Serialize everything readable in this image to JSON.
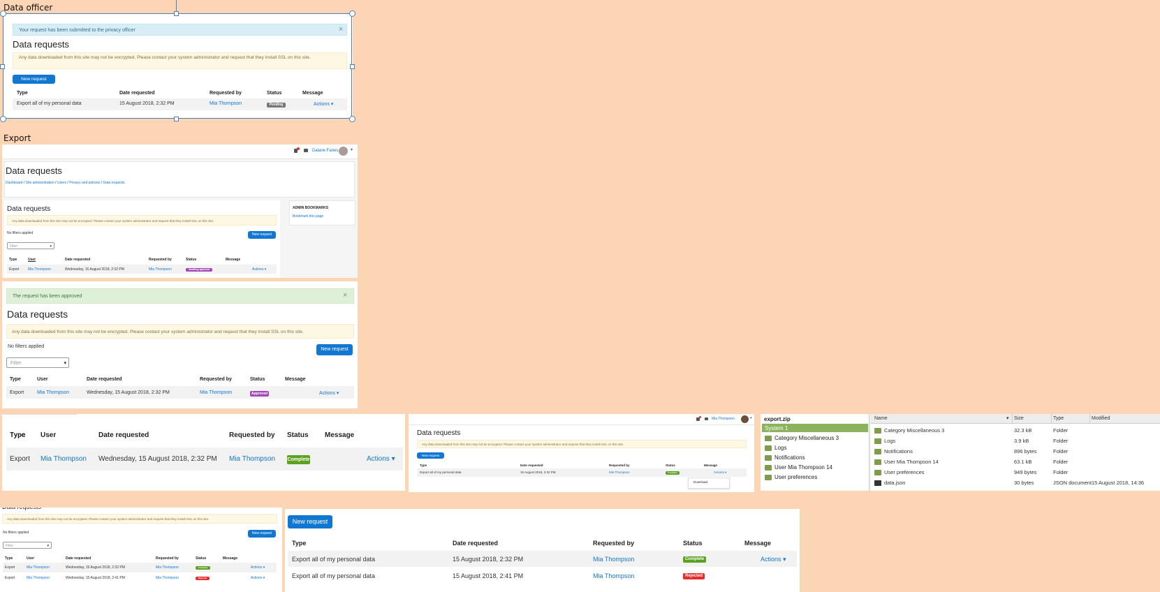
{
  "labels": {
    "data_officer": "Data officer",
    "export": "Export"
  },
  "common": {
    "page_title": "Data requests",
    "ssl_warning_a": "Any data downloaded from this site may not be encrypted. Please contact your system administrator and request that they install SSL on this site.",
    "new_request": "New request",
    "no_filters": "No filters applied",
    "filter_placeholder": "Filter",
    "actions": "Actions ▾",
    "close": "×"
  },
  "panel1": {
    "alert": "Your request has been submitted to the privacy officer",
    "headers": [
      "Type",
      "Date requested",
      "Requested by",
      "Status",
      "Message"
    ],
    "row": {
      "type": "Export all of my personal data",
      "date": "15 August 2018, 2:32 PM",
      "by": "Mia Thompson",
      "status": "Pending"
    }
  },
  "panel2": {
    "user": "Dalane Fanes",
    "breadcrumb": [
      "Dashboard",
      "Site administration",
      "Users",
      "Privacy and policies",
      "Data requests"
    ],
    "block_title": "ADMIN BOOKMARKS",
    "block_link": "Bookmark this page",
    "headers": [
      "Type",
      "User",
      "Date requested",
      "Requested by",
      "Status",
      "Message"
    ],
    "row": {
      "type": "Export",
      "user": "Mia Thompson",
      "date": "Wednesday, 15 August 2018, 2:32 PM",
      "by": "Mia Thompson",
      "status": "Awaiting approval"
    }
  },
  "panel3": {
    "alert": "The request has been approved",
    "headers": [
      "Type",
      "User",
      "Date requested",
      "Requested by",
      "Status",
      "Message"
    ],
    "row": {
      "type": "Export",
      "user": "Mia Thompson",
      "date": "Wednesday, 15 August 2018, 2:32 PM",
      "by": "Mia Thompson",
      "status": "Approved"
    }
  },
  "panel4": {
    "headers": [
      "Type",
      "User",
      "Date requested",
      "Requested by",
      "Status",
      "Message"
    ],
    "row": {
      "type": "Export",
      "user": "Mia Thompson",
      "date": "Wednesday, 15 August 2018, 2:32 PM",
      "by": "Mia Thompson",
      "status": "Complete"
    }
  },
  "panel5": {
    "user": "Mia Thompson",
    "headers": [
      "Type",
      "Date requested",
      "Requested by",
      "Status",
      "Message"
    ],
    "row": {
      "type": "Export all of my personal data",
      "date": "15 August 2018, 2:32 PM",
      "by": "Mia Thompson",
      "status": "Complete"
    },
    "menu_item": "Download"
  },
  "panel6": {
    "archive": "export.zip",
    "tree": [
      "System 1",
      "Category Miscellaneous 3",
      "Logs",
      "Notifications",
      "User Mia Thompson 14",
      "User preferences"
    ],
    "columns": [
      "Name",
      "Size",
      "Type",
      "Modified"
    ],
    "files": [
      {
        "name": "Category Miscellaneous 3",
        "size": "32.3 kB",
        "type": "Folder",
        "modified": ""
      },
      {
        "name": "Logs",
        "size": "3.9 kB",
        "type": "Folder",
        "modified": ""
      },
      {
        "name": "Notifications",
        "size": "896 bytes",
        "type": "Folder",
        "modified": ""
      },
      {
        "name": "User Mia Thompson 14",
        "size": "63.1 kB",
        "type": "Folder",
        "modified": ""
      },
      {
        "name": "User preferences",
        "size": "949 bytes",
        "type": "Folder",
        "modified": ""
      },
      {
        "name": "data.json",
        "size": "30 bytes",
        "type": "JSON document",
        "modified": "15 August 2018, 14:36"
      }
    ]
  },
  "panel7": {
    "headers": [
      "Type",
      "User",
      "Date requested",
      "Requested by",
      "Status",
      "Message"
    ],
    "rows": [
      {
        "type": "Export",
        "user": "Mia Thompson",
        "date": "Wednesday, 15 August 2018, 2:32 PM",
        "by": "Mia Thompson",
        "status": "Complete"
      },
      {
        "type": "Export",
        "user": "Mia Thompson",
        "date": "Wednesday, 15 August 2018, 2:41 PM",
        "by": "Mia Thompson",
        "status": "Rejected"
      }
    ]
  },
  "panel8": {
    "headers": [
      "Type",
      "Date requested",
      "Requested by",
      "Status",
      "Message"
    ],
    "rows": [
      {
        "type": "Export all of my personal data",
        "date": "15 August 2018, 2:32 PM",
        "by": "Mia Thompson",
        "status": "Complete"
      },
      {
        "type": "Export all of my personal data",
        "date": "15 August 2018, 2:41 PM",
        "by": "Mia Thompson",
        "status": "Rejected"
      }
    ]
  },
  "colors": {
    "link": "#1177d1",
    "canvas": "#fcd5b5",
    "pending": "#777777",
    "approved": "#a248b5",
    "complete": "#5ca120",
    "rejected": "#e52d2d"
  }
}
